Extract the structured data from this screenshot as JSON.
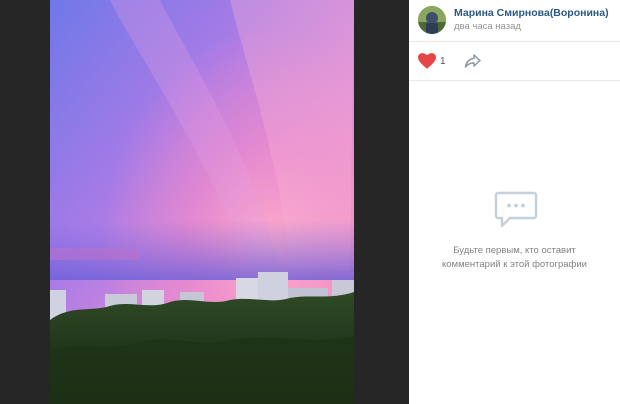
{
  "author": {
    "name": "Марина Смирнова(Воронина)",
    "time": "два часа назад"
  },
  "actions": {
    "like_count": "1"
  },
  "comments": {
    "empty_line1": "Будьте первым, кто оставит",
    "empty_line2": "комментарий к этой фотографии"
  },
  "colors": {
    "link": "#2a5885",
    "like": "#e64646",
    "muted": "#939393",
    "viewer_bg": "#262626"
  },
  "icons": [
    "heart-icon",
    "share-icon",
    "comment-bubble-icon"
  ]
}
